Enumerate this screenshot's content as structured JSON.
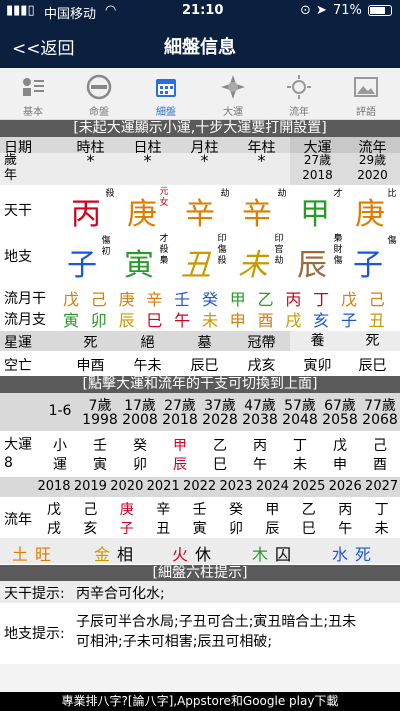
{
  "status": {
    "carrier": "中国移动",
    "time": "21:10",
    "battery": "71%"
  },
  "nav": {
    "back": "<<返回",
    "title": "細盤信息"
  },
  "tabs": [
    {
      "label": "基本"
    },
    {
      "label": "命盤"
    },
    {
      "label": "細盤"
    },
    {
      "label": "大運"
    },
    {
      "label": "流年"
    },
    {
      "label": "評語"
    }
  ],
  "notice": "[未起大運顯示小運,十步大運要打開設置]",
  "header": {
    "date": "日期",
    "year": "歲\n年",
    "cols": [
      "時柱",
      "日柱",
      "月柱",
      "年柱",
      "大運",
      "流年"
    ],
    "stars": [
      "*",
      "*",
      "*",
      "*"
    ],
    "dayun_age": "27歲",
    "dayun_year": "2018",
    "liunian_age": "29歲",
    "liunian_year": "2020"
  },
  "tiangan": {
    "label": "天干",
    "chars": [
      "丙",
      "庚",
      "辛",
      "辛",
      "甲",
      "庚"
    ],
    "notes": [
      "殺",
      "元女",
      "劫",
      "劫",
      "才",
      "比"
    ]
  },
  "dizhi": {
    "label": "地支",
    "chars": [
      "子",
      "寅",
      "丑",
      "未",
      "辰",
      "子"
    ],
    "notes": [
      "傷初",
      "才殺梟",
      "印傷殺",
      "印官劫",
      "梟財傷",
      "傷"
    ]
  },
  "liuyue": {
    "label_gan": "流月干",
    "label_zhi": "流月支",
    "gan": [
      "戊",
      "己",
      "庚",
      "辛",
      "壬",
      "癸",
      "甲",
      "乙",
      "丙",
      "丁",
      "戊",
      "己"
    ],
    "zhi": [
      "寅",
      "卯",
      "辰",
      "巳",
      "午",
      "未",
      "申",
      "酉",
      "戌",
      "亥",
      "子",
      "丑"
    ]
  },
  "xingyun": {
    "label": "星運",
    "vals": [
      "死",
      "絕",
      "墓",
      "冠帶",
      "養",
      "死"
    ]
  },
  "kongwang": {
    "label": "空亡",
    "vals": [
      "申酉",
      "午未",
      "辰巳",
      "戌亥",
      "寅卯",
      "辰巳"
    ]
  },
  "notice2": "[點擊大運和流年的干支可切換到上面]",
  "dayun": {
    "range": "1-6",
    "ages": [
      "7歲",
      "17歲",
      "27歲",
      "37歲",
      "47歲",
      "57歲",
      "67歲",
      "77歲"
    ],
    "years": [
      "1998",
      "2008",
      "2018",
      "2028",
      "2038",
      "2048",
      "2058",
      "2068"
    ],
    "label": "大運\n8",
    "gan": [
      "小",
      "壬",
      "癸",
      "甲",
      "乙",
      "丙",
      "丁",
      "戊",
      "己"
    ],
    "zhi": [
      "運",
      "寅",
      "卯",
      "辰",
      "巳",
      "午",
      "未",
      "申",
      "酉"
    ]
  },
  "liunian": {
    "years": [
      "2018",
      "2019",
      "2020",
      "2021",
      "2022",
      "2023",
      "2024",
      "2025",
      "2026",
      "2027"
    ],
    "label": "流年",
    "gan": [
      "戊",
      "己",
      "庚",
      "辛",
      "壬",
      "癸",
      "甲",
      "乙",
      "丙",
      "丁"
    ],
    "zhi": [
      "戌",
      "亥",
      "子",
      "丑",
      "寅",
      "卯",
      "辰",
      "巳",
      "午",
      "未"
    ]
  },
  "wuxing": [
    {
      "e": "土",
      "s": "旺"
    },
    {
      "e": "金",
      "s": "相"
    },
    {
      "e": "火",
      "s": "休"
    },
    {
      "e": "木",
      "s": "囚"
    },
    {
      "e": "水",
      "s": "死"
    }
  ],
  "notice3": "[細盤六柱提示]",
  "tip_gan": {
    "label": "天干提示:",
    "text": "丙辛合可化水;"
  },
  "tip_zhi": {
    "label": "地支提示:",
    "line1": "子辰可半合水局;子丑可合土;寅丑暗合土;丑未",
    "line2": "可相沖;子未可相害;辰丑可相破;"
  },
  "footer": "專業排八字?[論八字],Appstore和Google play下載"
}
